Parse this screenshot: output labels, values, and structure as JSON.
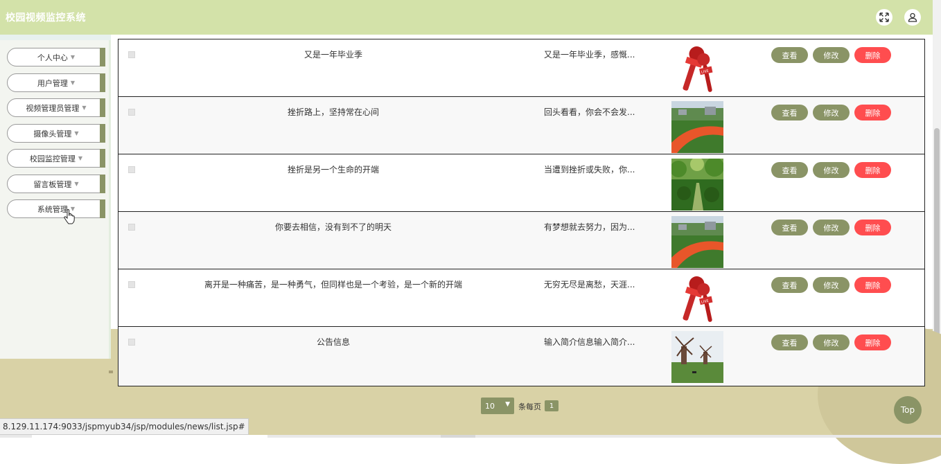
{
  "header": {
    "title": "校园视频监控系统",
    "fullscreen_icon": "expand-icon",
    "user_icon": "user-icon"
  },
  "sidebar": {
    "items": [
      {
        "label": "个人中心"
      },
      {
        "label": "用户管理"
      },
      {
        "label": "视频管理员管理"
      },
      {
        "label": "摄像头管理"
      },
      {
        "label": "校园监控管理"
      },
      {
        "label": "留言板管理"
      },
      {
        "label": "系统管理"
      }
    ]
  },
  "table": {
    "rows": [
      {
        "title": "又是一年毕业季",
        "intro": "又是一年毕业季，感慨...",
        "image": "live-microphone-image"
      },
      {
        "title": "挫折路上，坚持常在心间",
        "intro": "回头看看，你会不会发...",
        "image": "campus-track-image"
      },
      {
        "title": "挫折是另一个生命的开端",
        "intro": "当遭到挫折或失败，你...",
        "image": "tree-avenue-image"
      },
      {
        "title": "你要去相信，没有到不了的明天",
        "intro": "有梦想就去努力，因为...",
        "image": "campus-track-image"
      },
      {
        "title": "离开是一种痛苦，是一种勇气，但同样也是一个考验，是一个新的开端",
        "intro": "无穷无尽是离愁，天涯...",
        "image": "live-microphone-image"
      },
      {
        "title": "公告信息",
        "intro": "输入简介信息输入简介...",
        "image": "windmill-image"
      }
    ],
    "actions": {
      "view": "查看",
      "edit": "修改",
      "delete": "删除"
    }
  },
  "pagination": {
    "page_size": "10",
    "per_page_label": "条每页",
    "current_page": "1"
  },
  "top_button": "Top",
  "status_url": "8.129.11.174:9033/jspmyub34/jsp/modules/news/list.jsp#",
  "colors": {
    "header": "#d3e2a9",
    "accent": "#8a9466",
    "danger": "#ff4d4f",
    "tan": "#d9d2a6"
  }
}
